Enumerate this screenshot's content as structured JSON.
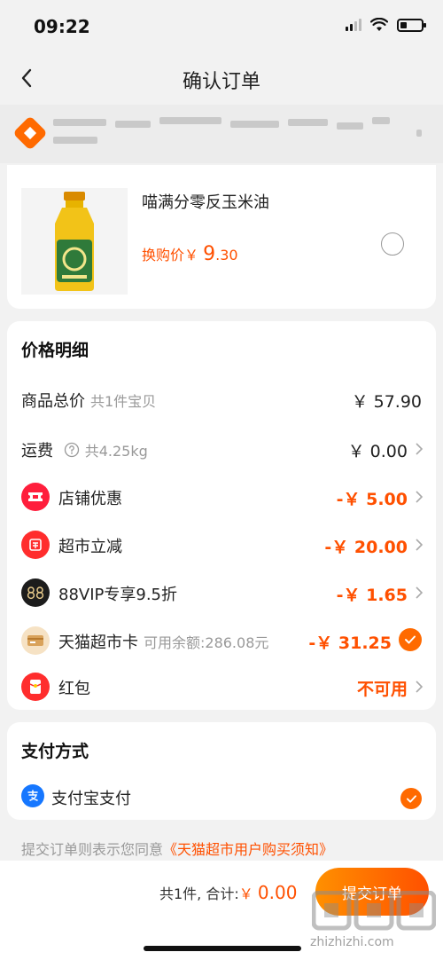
{
  "status_bar": {
    "time": "09:22"
  },
  "header": {
    "title": "确认订单"
  },
  "address": {
    "text": "北京…（已模糊）"
  },
  "product": {
    "name": "喵满分零反玉米油",
    "swap_label": "换购价￥",
    "swap_price_int": "9",
    "swap_price_dec": ".30"
  },
  "price_detail": {
    "title": "价格明细",
    "rows": [
      {
        "label": "商品总价",
        "sub": "共1件宝贝",
        "value": "￥ 57.90"
      },
      {
        "label": "运费",
        "sub": "共4.25kg",
        "value": "￥ 0.00"
      },
      {
        "label": "店铺优惠",
        "value": "-￥ 5.00"
      },
      {
        "label": "超市立减",
        "value": "-￥ 20.00"
      },
      {
        "label": "88VIP专享9.5折",
        "value": "-￥ 1.65"
      },
      {
        "label": "天猫超市卡",
        "sub": "可用余额:286.08元",
        "value": "-￥ 31.25"
      },
      {
        "label": "红包",
        "value": "不可用"
      }
    ]
  },
  "payment": {
    "title": "支付方式",
    "method": "支付宝支付"
  },
  "agreement": {
    "prefix": "提交订单则表示您同意",
    "link": "《天猫超市用户购买须知》"
  },
  "bottom": {
    "count": "共1件,",
    "total_label": "合计:",
    "currency": "￥",
    "total_value": "0.00",
    "submit_label": "提交订单"
  },
  "watermark": {
    "text": "zhizhizhi.com"
  },
  "colors": {
    "accent": "#ff5000",
    "background": "#f2f2f2"
  }
}
